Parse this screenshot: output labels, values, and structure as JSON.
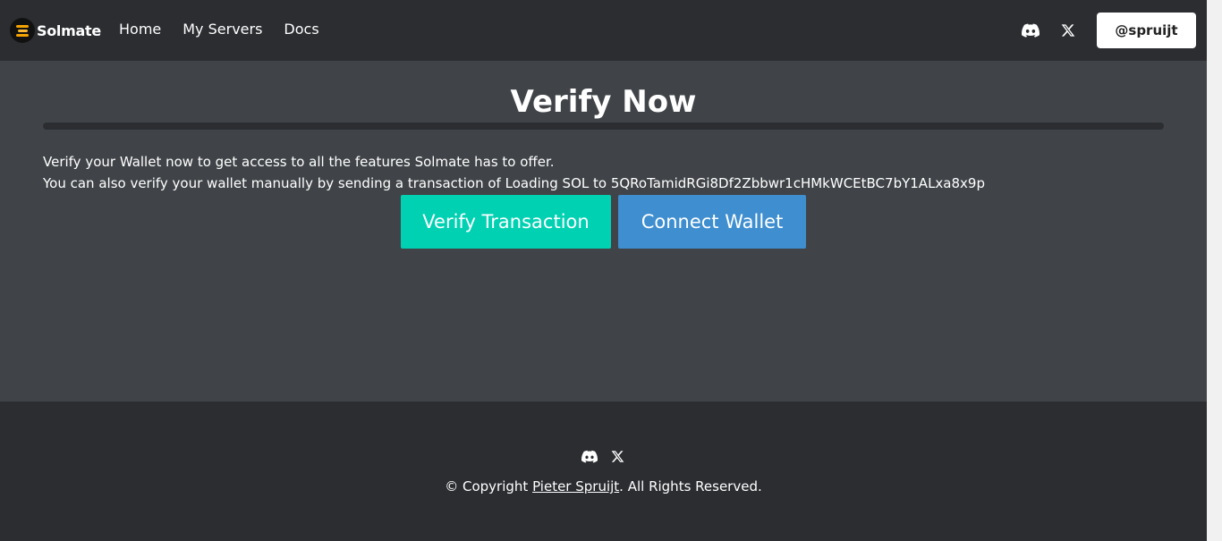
{
  "navbar": {
    "brand": "Solmate",
    "links": [
      "Home",
      "My Servers",
      "Docs"
    ],
    "icons": [
      "discord-icon",
      "x-icon"
    ],
    "user_button": "@spruijt"
  },
  "main": {
    "title": "Verify Now",
    "description_line1": "Verify your Wallet now to get access to all the features Solmate has to offer.",
    "description_line2": "You can also verify your wallet manually by sending a transaction of Loading SOL to 5QRoTamidRGi8Df2Zbbwr1cHMkWCEtBC7bY1ALxa8x9p",
    "verify_button": "Verify Transaction",
    "connect_button": "Connect Wallet"
  },
  "footer": {
    "icons": [
      "discord-icon",
      "x-icon"
    ],
    "copyright_prefix": "© Copyright ",
    "copyright_link": "Pieter Spruijt",
    "copyright_suffix": ". All Rights Reserved."
  },
  "colors": {
    "header_bg": "#2b2d31",
    "main_bg": "#404448",
    "verify_button": "#00d1b2",
    "connect_button": "#3e8ed0",
    "brand_accent": "#f5a300"
  }
}
